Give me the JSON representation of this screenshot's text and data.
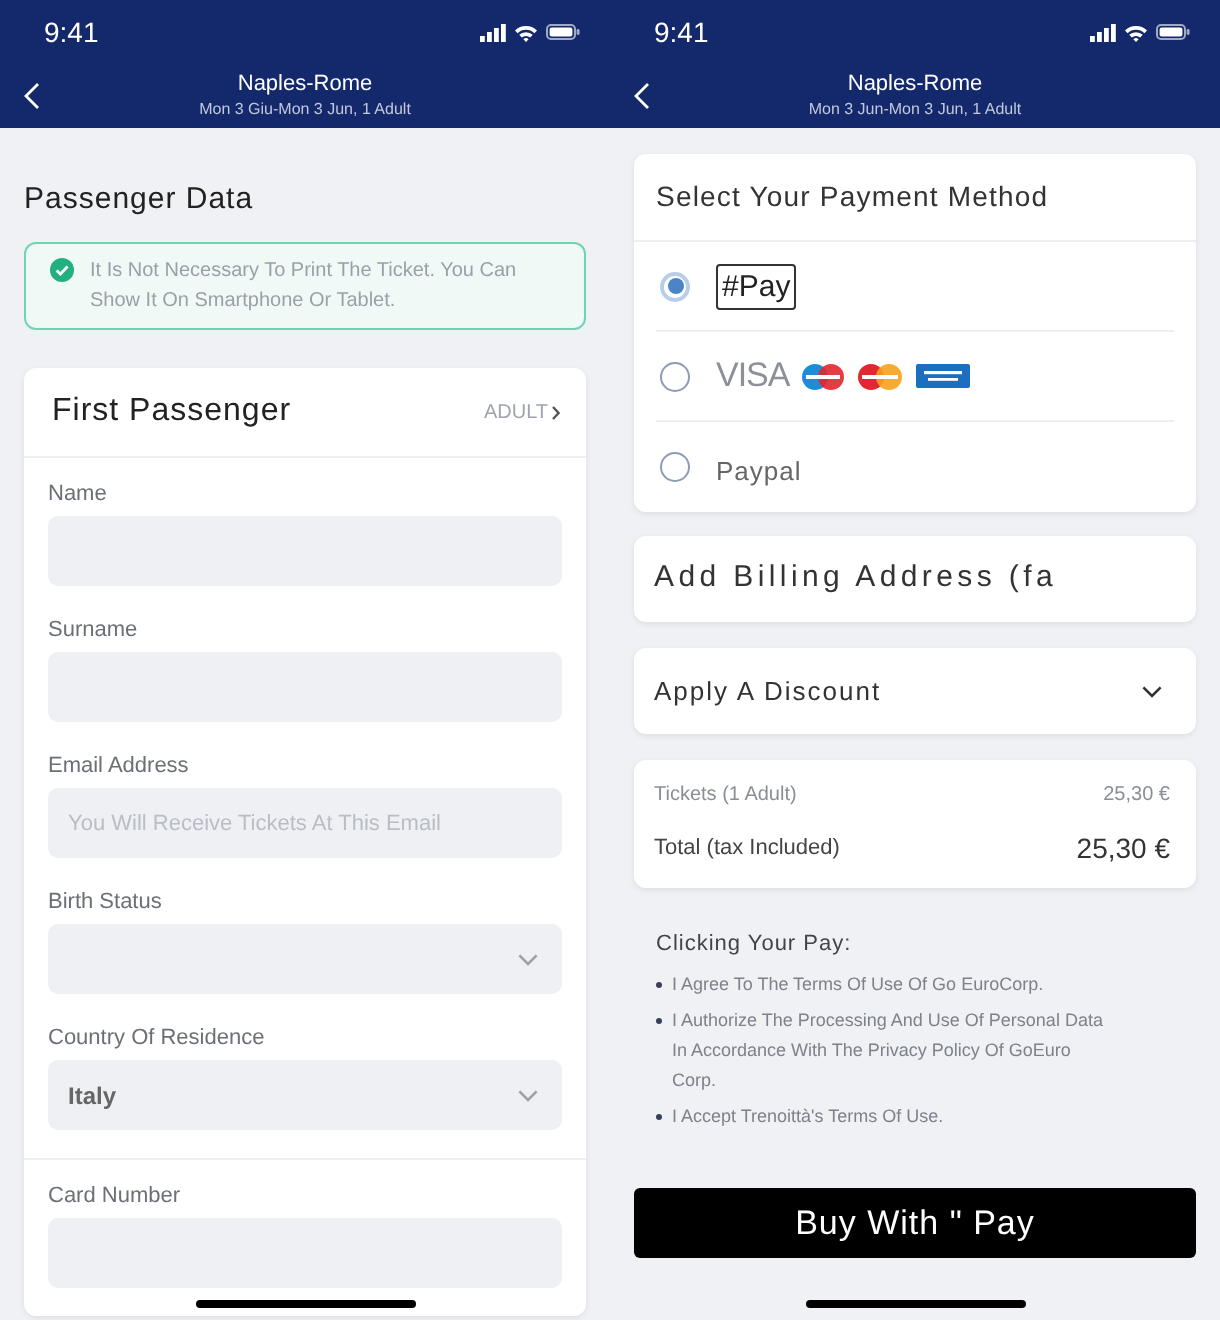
{
  "passenger_screen": {
    "status_bar": {
      "time": "9:41"
    },
    "header": {
      "title": "Naples-Rome",
      "subtitle": "Mon 3 Giu-Mon 3 Jun, 1 Adult"
    },
    "section_title": "Passenger Data",
    "notice": "It Is Not Necessary To Print The Ticket. You Can Show It On Smartphone Or Tablet.",
    "passenger_card": {
      "title": "First Passenger",
      "passenger_type": "ADULT",
      "field_groups": [
        {
          "fields": [
            {
              "kind": "text",
              "label": "Name"
            },
            {
              "kind": "text",
              "label": "Surname"
            },
            {
              "kind": "text",
              "label": "Email Address",
              "placeholder": "You Will Receive Tickets At This Email"
            },
            {
              "kind": "select",
              "label": "Birth Status"
            },
            {
              "kind": "select",
              "label": "Country Of Residence",
              "value": "Italy"
            }
          ]
        },
        {
          "fields": [
            {
              "kind": "text",
              "label": "Card Number"
            }
          ]
        }
      ]
    }
  },
  "payment_screen": {
    "status_bar": {
      "time": "9:41"
    },
    "header": {
      "title": "Naples-Rome",
      "subtitle": "Mon 3 Jun-Mon 3 Jun, 1 Adult"
    },
    "payment_card": {
      "title": "Select Your Payment Method",
      "methods": [
        {
          "kind": "boxed",
          "label": "#Pay",
          "selected": true
        },
        {
          "kind": "cards",
          "label": "VISA",
          "selected": false
        },
        {
          "kind": "text",
          "label": "Paypal",
          "selected": false
        }
      ]
    },
    "billing": "Add Billing Address (fa",
    "discount": "Apply A Discount",
    "summary": {
      "rows": [
        {
          "kind": "item",
          "label": "Tickets (1 Adult)",
          "amount": "25,30 €"
        },
        {
          "kind": "total",
          "label": "Total (tax Included)",
          "amount": "25,30 €"
        }
      ]
    },
    "terms": {
      "title": "Clicking Your Pay:",
      "items": [
        "I Agree To The Terms Of Use Of Go EuroCorp.",
        "I Authorize The Processing And Use Of Personal Data In Accordance With The Privacy Policy Of GoEuro Corp.",
        "I Accept Trenoittà's Terms Of Use."
      ]
    },
    "buy_button": "Buy With \" Pay"
  }
}
